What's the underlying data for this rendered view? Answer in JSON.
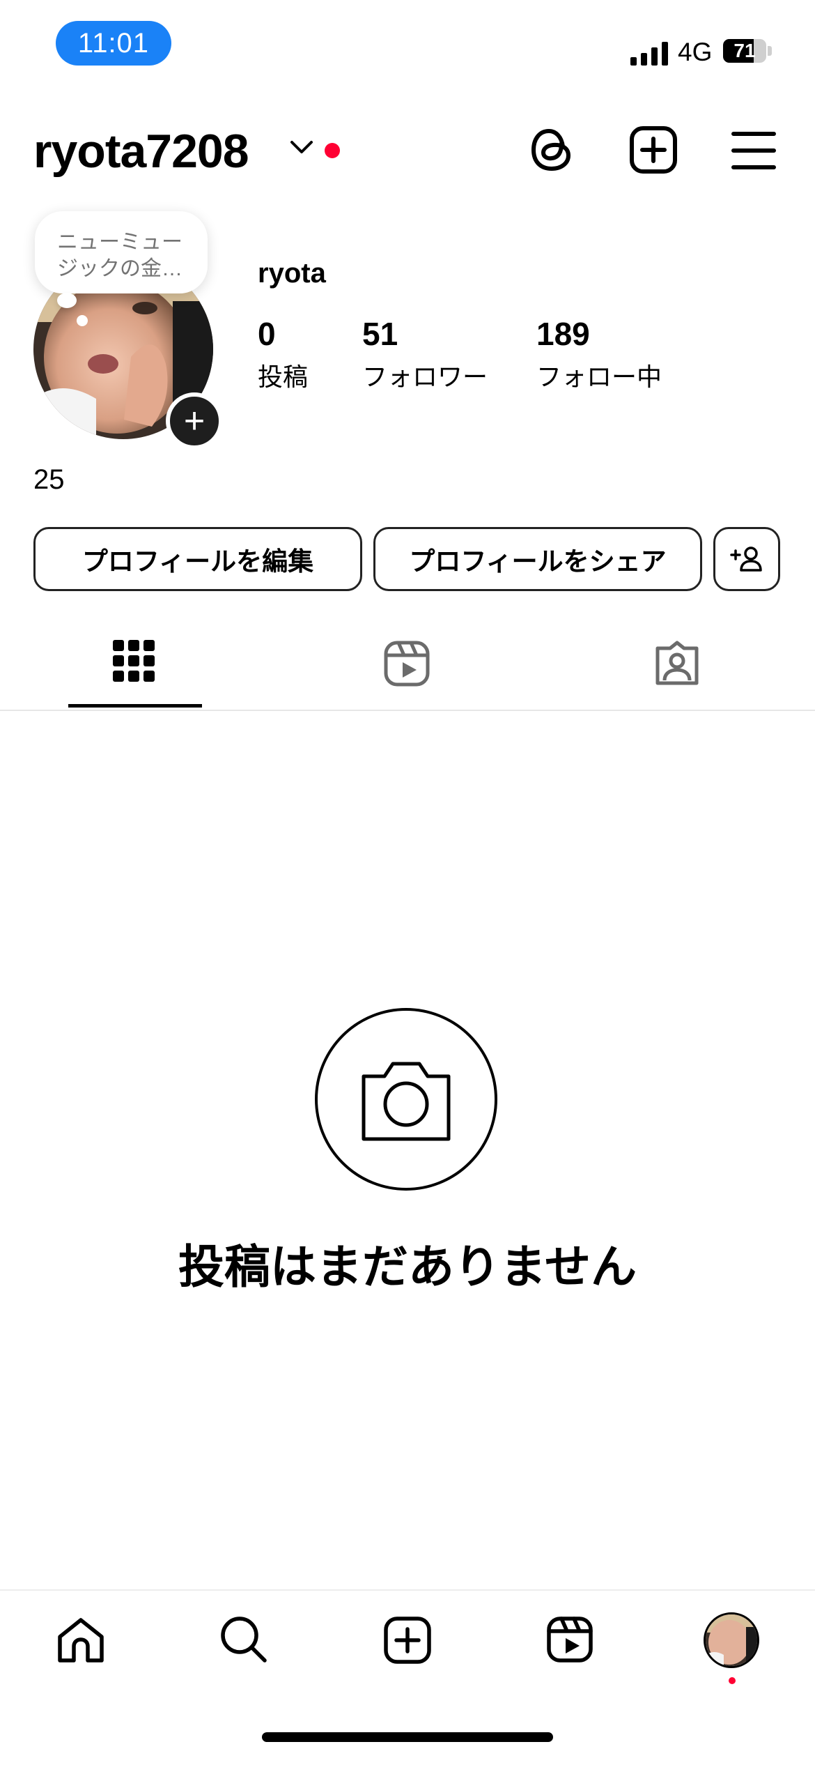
{
  "status_bar": {
    "time": "11:01",
    "network": "4G",
    "battery": "71",
    "battery_level": 0.71
  },
  "header": {
    "username": "ryota7208"
  },
  "profile": {
    "note_text": "ニューミュージックの金…",
    "display_name": "ryota",
    "stats": [
      {
        "value": "0",
        "label": "投稿"
      },
      {
        "value": "51",
        "label": "フォロワー"
      },
      {
        "value": "189",
        "label": "フォロー中"
      }
    ],
    "bio": "25"
  },
  "actions": {
    "edit_profile": "プロフィールを編集",
    "share_profile": "プロフィールをシェア"
  },
  "tabs": [
    {
      "icon": "grid-icon",
      "active": true
    },
    {
      "icon": "reels-icon",
      "active": false
    },
    {
      "icon": "tagged-icon",
      "active": false
    }
  ],
  "empty_state": {
    "message": "投稿はまだありません"
  },
  "bottom_nav": [
    "home-icon",
    "search-icon",
    "create-icon",
    "reels-icon",
    "profile-avatar"
  ],
  "colors": {
    "accent_blue": "#1a82f7",
    "notification_red": "#ff0033"
  }
}
